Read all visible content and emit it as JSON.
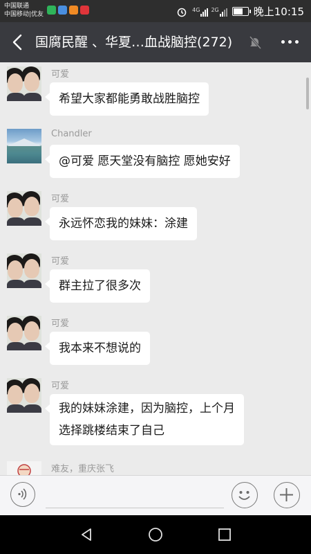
{
  "status_bar": {
    "carrier_line1": "中国联通",
    "carrier_line2": "中国移动|优友",
    "network_1": "4G",
    "network_2": "2G",
    "time": "晚上10:15",
    "icons": [
      "alarm-icon",
      "signal-icon",
      "battery-icon"
    ],
    "app_icons": [
      "app-icon-green",
      "app-icon-blue",
      "app-icon-orange",
      "app-icon-red"
    ]
  },
  "header": {
    "title": "国腐民醒 、华夏…血战脑控(272)",
    "back_icon": "back-chevron-icon",
    "mute_icon": "bell-muted-icon",
    "more_icon": "more-dots-icon"
  },
  "messages": [
    {
      "sender": "可爱",
      "avatar": "couple-photo",
      "text": [
        "希望大家都能勇敢战胜脑控"
      ]
    },
    {
      "sender": "Chandler",
      "avatar": "lake-mountain-photo",
      "text": [
        "@可爱  愿天堂没有脑控 愿她安好"
      ]
    },
    {
      "sender": "可爱",
      "avatar": "couple-photo",
      "text": [
        "永远怀恋我的妹妹：涂建"
      ]
    },
    {
      "sender": "可爱",
      "avatar": "couple-photo",
      "text": [
        "群主拉了很多次"
      ]
    },
    {
      "sender": "可爱",
      "avatar": "couple-photo",
      "text": [
        "我本来不想说的"
      ]
    },
    {
      "sender": "可爱",
      "avatar": "couple-photo",
      "text": [
        "我的妹妹涂建，因为脑控，上个月",
        "选择跳楼结束了自己"
      ]
    },
    {
      "sender": "难友，重庆张飞",
      "avatar": "cartoon-icon",
      "text": []
    }
  ],
  "input_bar": {
    "voice_icon": "voice-input-icon",
    "emoji_icon": "emoji-icon",
    "plus_icon": "add-more-icon"
  },
  "nav_bar": {
    "back_icon": "nav-back-icon",
    "home_icon": "nav-home-icon",
    "recents_icon": "nav-recents-icon"
  },
  "colors": {
    "status_bar_bg": "#2e2e2e",
    "header_bg": "#393a3f",
    "chat_bg": "#ebebeb",
    "bubble_bg": "#ffffff",
    "sender_text": "#9a9a9a"
  }
}
